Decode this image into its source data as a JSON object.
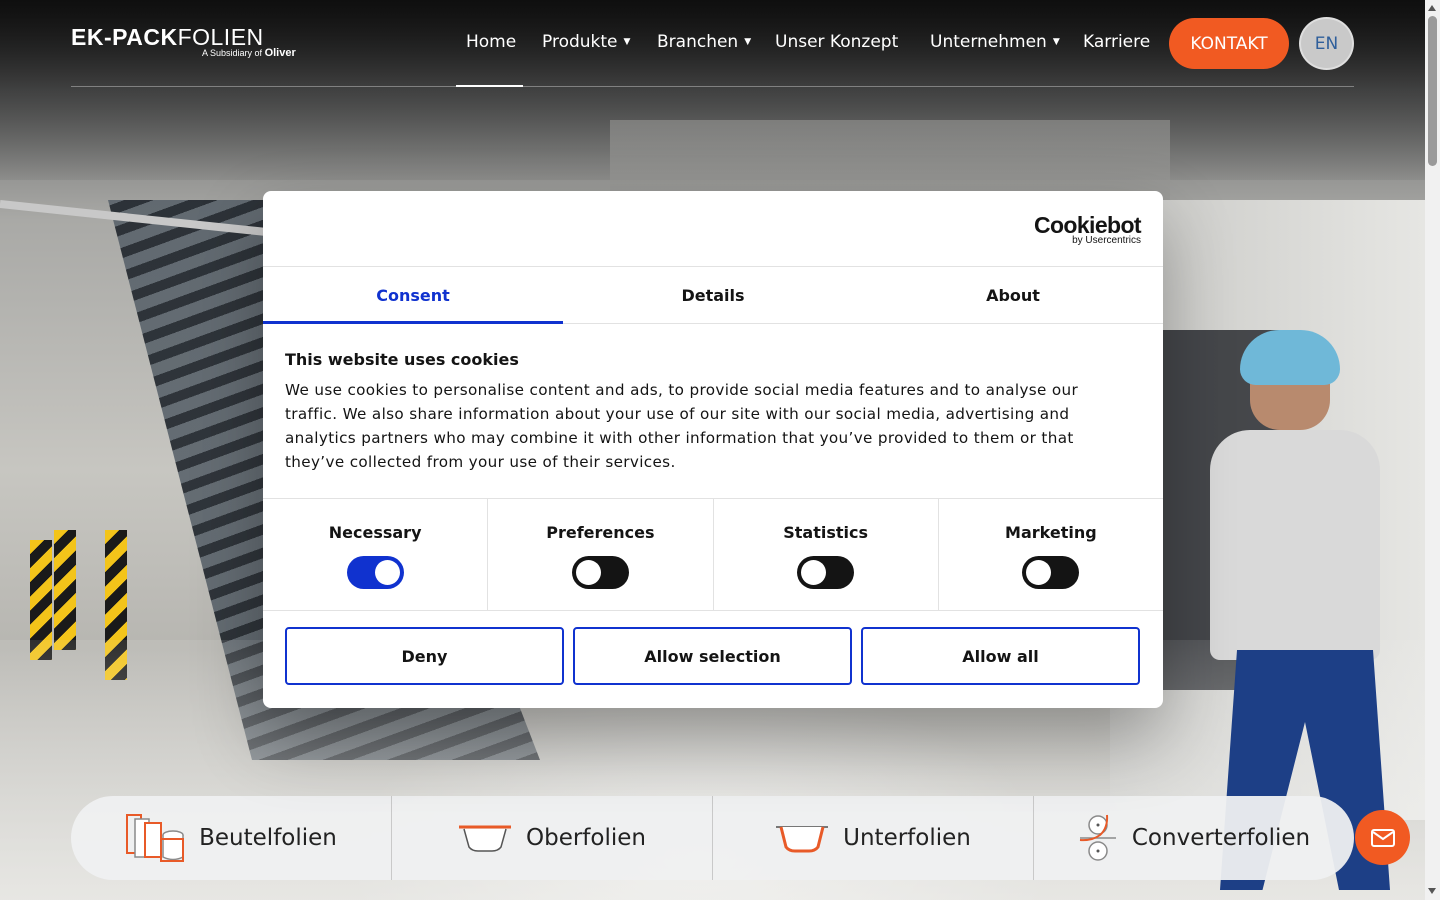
{
  "header": {
    "logo": {
      "part1": "EK-PACK",
      "part2": "FOLIEN",
      "subsidiary_prefix": "A Subsidiary of",
      "subsidiary_brand": "Oliver"
    },
    "nav": [
      {
        "label": "Home",
        "dropdown": false,
        "active": true
      },
      {
        "label": "Produkte",
        "dropdown": true
      },
      {
        "label": "Branchen",
        "dropdown": true
      },
      {
        "label": "Unser Konzept",
        "dropdown": false
      },
      {
        "label": "Unternehmen",
        "dropdown": true
      },
      {
        "label": "Karriere",
        "dropdown": false
      }
    ],
    "cta_label": "KONTAKT",
    "language": "EN"
  },
  "categories": [
    {
      "label": "Beutelfolien",
      "icon": "bag-film-icon"
    },
    {
      "label": "Oberfolien",
      "icon": "top-film-tray-icon"
    },
    {
      "label": "Unterfolien",
      "icon": "bottom-film-tray-icon"
    },
    {
      "label": "Converterfolien",
      "icon": "converter-roll-icon"
    }
  ],
  "chat_icon": "mail-icon",
  "cookie_dialog": {
    "brand": "Cookiebot",
    "brand_sub": "by Usercentrics",
    "tabs": [
      "Consent",
      "Details",
      "About"
    ],
    "active_tab": "Consent",
    "title": "This website uses cookies",
    "body": "We use cookies to personalise content and ads, to provide social media features and to analyse our traffic. We also share information about your use of our site with our social media, advertising and analytics partners who may combine it with other information that you’ve provided to them or that they’ve collected from your use of their services.",
    "toggles": [
      {
        "label": "Necessary",
        "checked": true
      },
      {
        "label": "Preferences",
        "checked": false
      },
      {
        "label": "Statistics",
        "checked": false
      },
      {
        "label": "Marketing",
        "checked": false
      }
    ],
    "buttons": [
      "Deny",
      "Allow selection",
      "Allow all"
    ]
  },
  "colors": {
    "accent_orange": "#f15a22",
    "cookiebot_blue": "#1032cf",
    "icon_orange": "#e85a28"
  }
}
